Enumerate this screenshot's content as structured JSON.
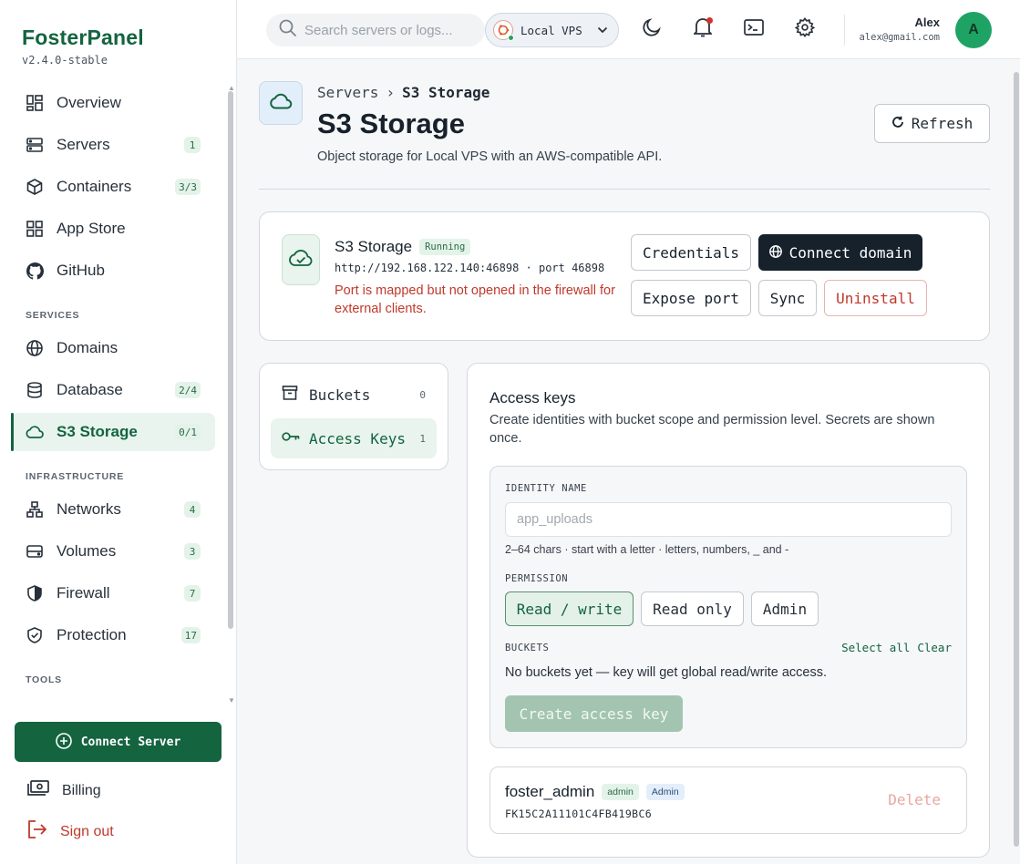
{
  "brand": {
    "name": "FosterPanel",
    "version": "v2.4.0-stable"
  },
  "sidebar": {
    "items": [
      {
        "label": "Overview",
        "icon": "grid-icon",
        "badge": ""
      },
      {
        "label": "Servers",
        "icon": "server-icon",
        "badge": "1"
      },
      {
        "label": "Containers",
        "icon": "box-icon",
        "badge": "3/3"
      },
      {
        "label": "App Store",
        "icon": "apps-icon",
        "badge": ""
      },
      {
        "label": "GitHub",
        "icon": "github-icon",
        "badge": ""
      }
    ],
    "sections": {
      "services": "SERVICES",
      "infrastructure": "INFRASTRUCTURE",
      "tools": "TOOLS"
    },
    "services": [
      {
        "label": "Domains",
        "icon": "globe-icon",
        "badge": ""
      },
      {
        "label": "Database",
        "icon": "database-icon",
        "badge": "2/4"
      },
      {
        "label": "S3 Storage",
        "icon": "cloud-icon",
        "badge": "0/1",
        "active": true
      }
    ],
    "infrastructure": [
      {
        "label": "Networks",
        "icon": "network-icon",
        "badge": "4"
      },
      {
        "label": "Volumes",
        "icon": "hard-drive-icon",
        "badge": "3"
      },
      {
        "label": "Firewall",
        "icon": "shield-icon",
        "badge": "7"
      },
      {
        "label": "Protection",
        "icon": "shield-check-icon",
        "badge": "17"
      }
    ],
    "connect_label": "Connect Server",
    "billing_label": "Billing",
    "signout_label": "Sign out"
  },
  "topbar": {
    "search_placeholder": "Search servers or logs...",
    "server_name": "Local VPS",
    "user_name": "Alex",
    "user_email": "alex@gmail.com",
    "avatar_initial": "A"
  },
  "page": {
    "breadcrumb_parent": "Servers",
    "breadcrumb_sep": "›",
    "breadcrumb_current": "S3 Storage",
    "title": "S3 Storage",
    "subtitle": "Object storage for Local VPS with an AWS-compatible API.",
    "refresh_label": "Refresh"
  },
  "service": {
    "name": "S3 Storage",
    "status": "Running",
    "url": "http://192.168.122.140:46898 · port 46898",
    "warning": "Port is mapped but not opened in the firewall for external clients.",
    "buttons": {
      "credentials": "Credentials",
      "connect_domain": "Connect domain",
      "expose_port": "Expose port",
      "sync": "Sync",
      "uninstall": "Uninstall"
    }
  },
  "tabs": [
    {
      "label": "Buckets",
      "count": "0"
    },
    {
      "label": "Access Keys",
      "count": "1"
    }
  ],
  "access_keys": {
    "title": "Access keys",
    "description": "Create identities with bucket scope and permission level. Secrets are shown once.",
    "identity_label": "IDENTITY NAME",
    "identity_placeholder": "app_uploads",
    "identity_hint": "2–64 chars · start with a letter · letters, numbers, _ and -",
    "permission_label": "PERMISSION",
    "permissions": [
      "Read / write",
      "Read only",
      "Admin"
    ],
    "buckets_label": "BUCKETS",
    "select_all": "Select all",
    "clear": "Clear",
    "buckets_empty": "No buckets yet — key will get global read/write access.",
    "create_label": "Create access key",
    "keys": [
      {
        "name": "foster_admin",
        "tag1": "admin",
        "tag2": "Admin",
        "id": "FK15C2A11101C4FB419BC6",
        "delete_label": "Delete"
      }
    ]
  },
  "colors": {
    "brand": "#13643f",
    "danger": "#c0392b",
    "dark": "#17212b"
  }
}
